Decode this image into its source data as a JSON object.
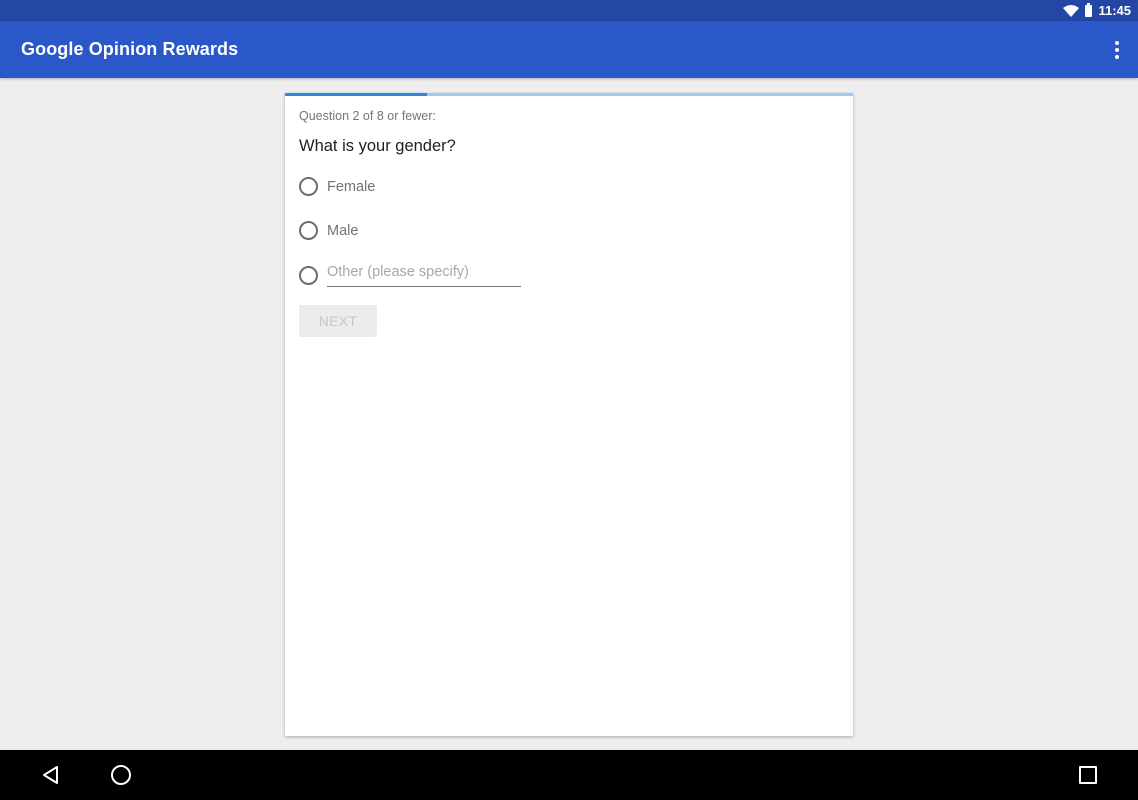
{
  "status_bar": {
    "time": "11:45",
    "icons": [
      "wifi-icon",
      "battery-icon"
    ]
  },
  "app_bar": {
    "title": "Google Opinion Rewards",
    "menu_icon": "more-vert-icon"
  },
  "survey": {
    "progress": {
      "current": 2,
      "total": 8,
      "fraction": 0.25
    },
    "question_count": "Question 2 of 8 or fewer:",
    "question": "What is your gender?",
    "options": [
      {
        "label": "Female",
        "selected": false
      },
      {
        "label": "Male",
        "selected": false
      },
      {
        "label": "",
        "placeholder": "Other (please specify)",
        "selected": false,
        "is_text_input": true
      }
    ],
    "next_label": "NEXT",
    "next_enabled": false
  },
  "colors": {
    "status_bar": "#2447a6",
    "app_bar": "#2b58c9",
    "progress_fill": "#2d88e0",
    "progress_track": "#9fcaf2",
    "background": "#eeeeee"
  },
  "nav_bar": {
    "buttons": [
      "back-icon",
      "home-icon",
      "recents-icon"
    ]
  }
}
